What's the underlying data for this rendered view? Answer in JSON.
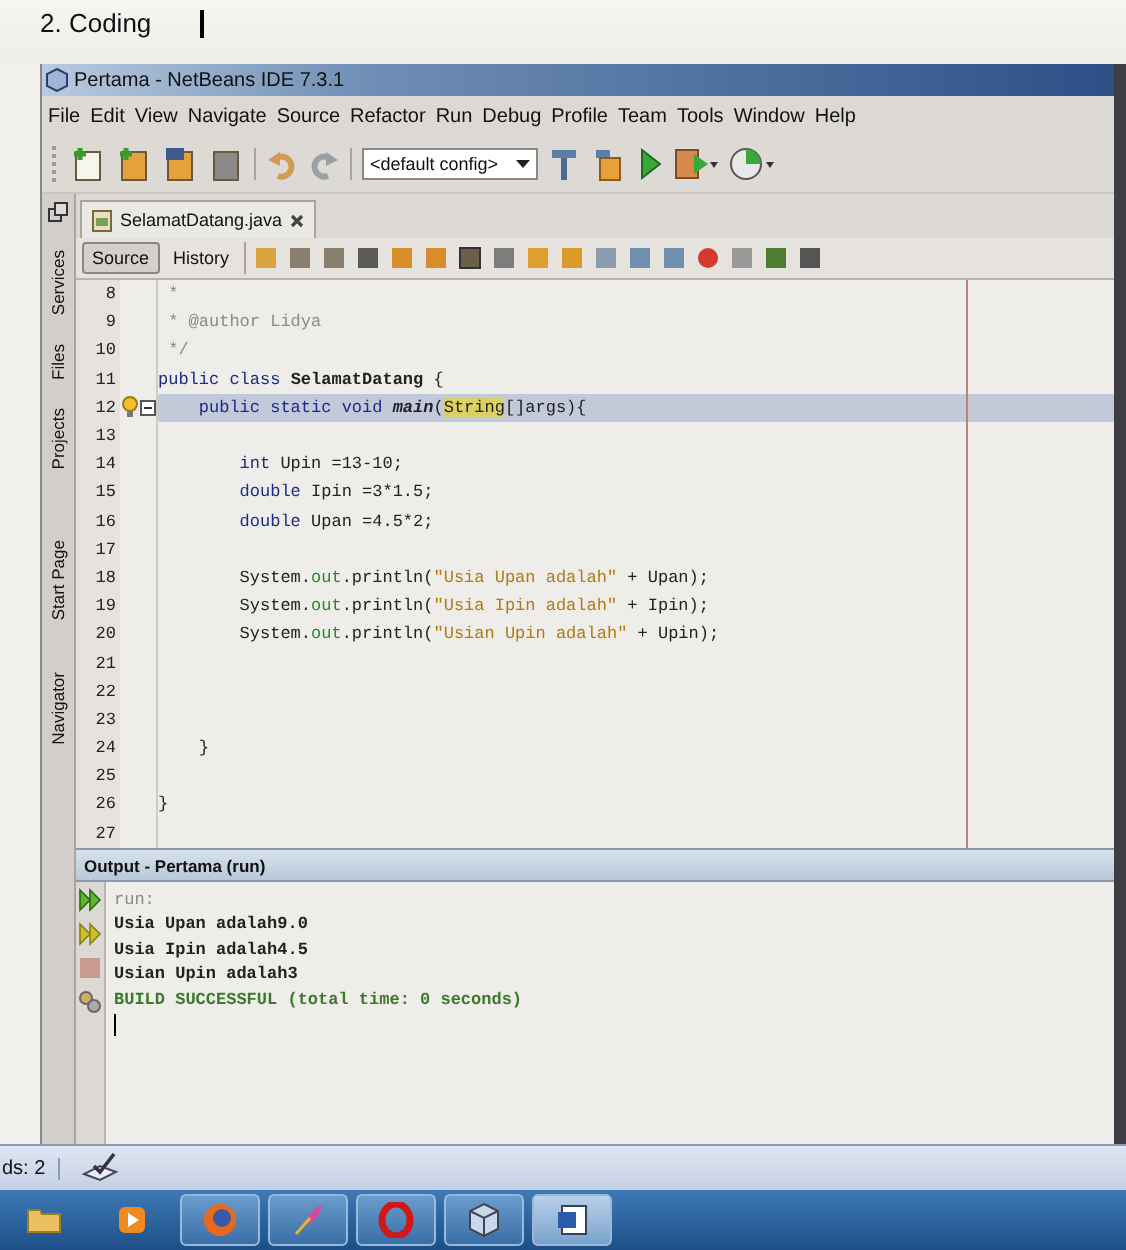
{
  "document": {
    "heading": "2. Coding"
  },
  "window": {
    "title": "Pertama - NetBeans IDE 7.3.1"
  },
  "menu": [
    "File",
    "Edit",
    "View",
    "Navigate",
    "Source",
    "Refactor",
    "Run",
    "Debug",
    "Profile",
    "Team",
    "Tools",
    "Window",
    "Help"
  ],
  "toolbar": {
    "config": "<default config>"
  },
  "side_tabs": [
    "Services",
    "Files",
    "Projects",
    "Start Page",
    "Navigator"
  ],
  "editor_tab": {
    "label": "SelamatDatang.java"
  },
  "editor_modes": [
    {
      "label": "Source",
      "selected": true
    },
    {
      "label": "History",
      "selected": false
    }
  ],
  "code": {
    "lines": [
      {
        "number": "8",
        "highlighted": false,
        "tokens": [
          {
            "kind": "comment",
            "text": " *"
          }
        ]
      },
      {
        "number": "9",
        "highlighted": false,
        "tokens": [
          {
            "kind": "comment",
            "text": " * @author Lidya"
          }
        ]
      },
      {
        "number": "10",
        "highlighted": false,
        "tokens": [
          {
            "kind": "comment",
            "text": " */"
          }
        ]
      },
      {
        "number": "11",
        "highlighted": false,
        "tokens": [
          {
            "kind": "keyword",
            "text": "public class "
          },
          {
            "kind": "classname",
            "text": "SelamatDatang"
          },
          {
            "kind": "plain",
            "text": " {"
          }
        ]
      },
      {
        "number": "12",
        "highlighted": true,
        "tokens": [
          {
            "kind": "keyword",
            "text": "    public static void "
          },
          {
            "kind": "method",
            "text": "main"
          },
          {
            "kind": "plain",
            "text": "("
          },
          {
            "kind": "match",
            "text": "String"
          },
          {
            "kind": "plain",
            "text": "[]args){"
          }
        ]
      },
      {
        "number": "13",
        "highlighted": false
      },
      {
        "number": "14",
        "highlighted": false,
        "tokens": [
          {
            "kind": "keyword",
            "text": "        int"
          },
          {
            "kind": "plain",
            "text": " Upin =13-10;"
          }
        ]
      },
      {
        "number": "15",
        "highlighted": false,
        "tokens": [
          {
            "kind": "keyword",
            "text": "        double"
          },
          {
            "kind": "plain",
            "text": " Ipin =3*1.5;"
          }
        ]
      },
      {
        "number": "16",
        "highlighted": false,
        "tokens": [
          {
            "kind": "keyword",
            "text": "        double"
          },
          {
            "kind": "plain",
            "text": " Upan =4.5*2;"
          }
        ]
      },
      {
        "number": "17",
        "highlighted": false
      },
      {
        "number": "18",
        "highlighted": false,
        "tokens": [
          {
            "kind": "plain",
            "text": "        System."
          },
          {
            "kind": "field",
            "text": "out"
          },
          {
            "kind": "plain",
            "text": ".println("
          },
          {
            "kind": "string",
            "text": "\"Usia Upan adalah\""
          },
          {
            "kind": "plain",
            "text": " + Upan);"
          }
        ]
      },
      {
        "number": "19",
        "highlighted": false,
        "tokens": [
          {
            "kind": "plain",
            "text": "        System."
          },
          {
            "kind": "field",
            "text": "out"
          },
          {
            "kind": "plain",
            "text": ".println("
          },
          {
            "kind": "string",
            "text": "\"Usia Ipin adalah\""
          },
          {
            "kind": "plain",
            "text": " + Ipin);"
          }
        ]
      },
      {
        "number": "20",
        "highlighted": false,
        "tokens": [
          {
            "kind": "plain",
            "text": "        System."
          },
          {
            "kind": "field",
            "text": "out"
          },
          {
            "kind": "plain",
            "text": ".println("
          },
          {
            "kind": "string",
            "text": "\"Usian Upin adalah\""
          },
          {
            "kind": "plain",
            "text": " + Upin);"
          }
        ]
      },
      {
        "number": "21",
        "highlighted": false
      },
      {
        "number": "22",
        "highlighted": false
      },
      {
        "number": "23",
        "highlighted": false
      },
      {
        "number": "24",
        "highlighted": false,
        "tokens": [
          {
            "kind": "plain",
            "text": "    }"
          }
        ]
      },
      {
        "number": "25",
        "highlighted": false
      },
      {
        "number": "26",
        "highlighted": false,
        "tokens": [
          {
            "kind": "plain",
            "text": "}"
          }
        ]
      },
      {
        "number": "27",
        "highlighted": false
      }
    ]
  },
  "output": {
    "title": "Output - Pertama (run)",
    "lines": [
      {
        "kind": "info",
        "text": "run:"
      },
      {
        "kind": "plain",
        "text": "Usia Upan adalah9.0"
      },
      {
        "kind": "plain",
        "text": "Usia Ipin adalah4.5"
      },
      {
        "kind": "plain",
        "text": "Usian Upin adalah3"
      },
      {
        "kind": "success",
        "text": "BUILD SUCCESSFUL (total time: 0 seconds)"
      }
    ]
  },
  "status_bar": {
    "text": "ds: 2"
  }
}
